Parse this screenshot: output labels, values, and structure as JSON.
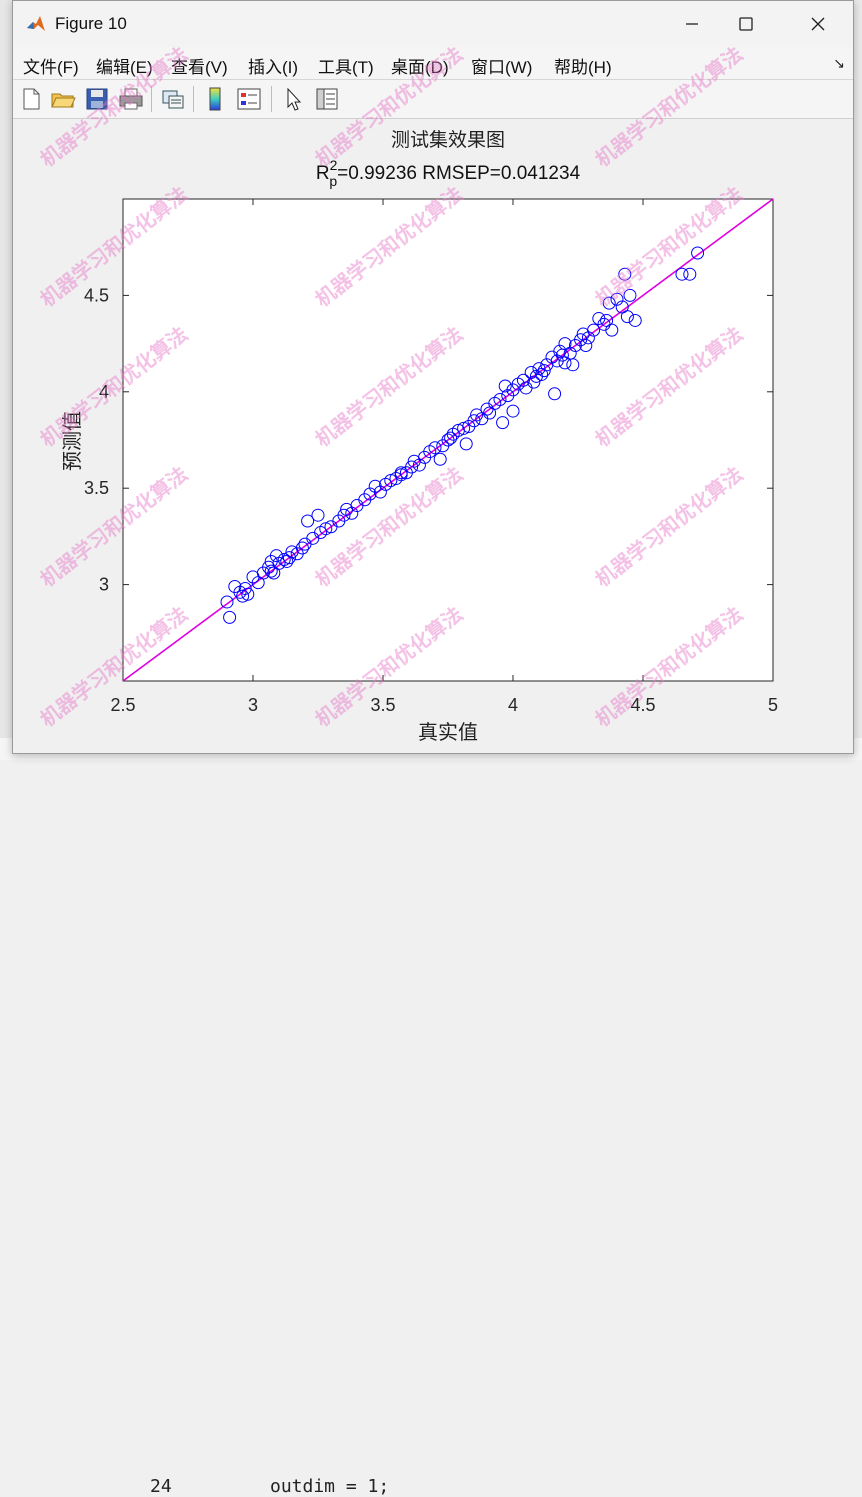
{
  "window": {
    "title": "Figure 10"
  },
  "menu": [
    "文件(F)",
    "编辑(E)",
    "查看(V)",
    "插入(I)",
    "工具(T)",
    "桌面(D)",
    "窗口(W)",
    "帮助(H)"
  ],
  "toolbar": [
    "new-figure-icon",
    "open-folder-icon",
    "save-icon",
    "print-icon",
    "link-plot-icon",
    "colorbar-icon",
    "legend-icon",
    "pointer-icon",
    "property-editor-icon"
  ],
  "background": {
    "line_number": "24",
    "code": "outdim = 1;"
  },
  "watermark": "机器学习和优化算法",
  "chart_data": {
    "type": "scatter",
    "title": "测试集效果图",
    "subtitle": {
      "r": "R",
      "sup": "2",
      "sub": "p",
      "rest": "=0.99236  RMSEP=0.041234"
    },
    "xlabel": "真实值",
    "ylabel": "预测值",
    "xlim": [
      2.5,
      5
    ],
    "ylim": [
      2.5,
      5
    ],
    "xticks": [
      "2.5",
      "3",
      "3.5",
      "4",
      "4.5",
      "5"
    ],
    "yticks": [
      "3",
      "3.5",
      "4",
      "4.5"
    ],
    "ytick_values": [
      3,
      3.5,
      4,
      4.5
    ],
    "xtick_values": [
      2.5,
      3,
      3.5,
      4,
      4.5,
      5
    ],
    "marker_color": "#0000ff",
    "line_color": "#e000e0",
    "line": [
      [
        2.5,
        2.5
      ],
      [
        5,
        5
      ]
    ],
    "points": [
      [
        2.9,
        2.91
      ],
      [
        2.91,
        2.83
      ],
      [
        2.93,
        2.99
      ],
      [
        2.95,
        2.96
      ],
      [
        2.96,
        2.94
      ],
      [
        2.97,
        2.98
      ],
      [
        2.98,
        2.95
      ],
      [
        3.0,
        3.04
      ],
      [
        3.02,
        3.01
      ],
      [
        3.04,
        3.06
      ],
      [
        3.06,
        3.09
      ],
      [
        3.07,
        3.12
      ],
      [
        3.08,
        3.06
      ],
      [
        3.09,
        3.15
      ],
      [
        3.1,
        3.11
      ],
      [
        3.12,
        3.13
      ],
      [
        3.14,
        3.14
      ],
      [
        3.15,
        3.17
      ],
      [
        3.17,
        3.16
      ],
      [
        3.19,
        3.19
      ],
      [
        3.2,
        3.21
      ],
      [
        3.21,
        3.33
      ],
      [
        3.23,
        3.24
      ],
      [
        3.25,
        3.36
      ],
      [
        3.26,
        3.27
      ],
      [
        3.28,
        3.29
      ],
      [
        3.3,
        3.3
      ],
      [
        3.33,
        3.33
      ],
      [
        3.35,
        3.36
      ],
      [
        3.36,
        3.39
      ],
      [
        3.38,
        3.37
      ],
      [
        3.4,
        3.41
      ],
      [
        3.43,
        3.44
      ],
      [
        3.45,
        3.47
      ],
      [
        3.47,
        3.51
      ],
      [
        3.49,
        3.48
      ],
      [
        3.51,
        3.52
      ],
      [
        3.53,
        3.54
      ],
      [
        3.55,
        3.55
      ],
      [
        3.57,
        3.57
      ],
      [
        3.59,
        3.58
      ],
      [
        3.61,
        3.61
      ],
      [
        3.62,
        3.64
      ],
      [
        3.64,
        3.62
      ],
      [
        3.66,
        3.66
      ],
      [
        3.68,
        3.69
      ],
      [
        3.7,
        3.71
      ],
      [
        3.72,
        3.65
      ],
      [
        3.73,
        3.72
      ],
      [
        3.75,
        3.75
      ],
      [
        3.77,
        3.78
      ],
      [
        3.79,
        3.8
      ],
      [
        3.81,
        3.81
      ],
      [
        3.82,
        3.73
      ],
      [
        3.83,
        3.82
      ],
      [
        3.85,
        3.85
      ],
      [
        3.86,
        3.88
      ],
      [
        3.88,
        3.86
      ],
      [
        3.9,
        3.91
      ],
      [
        3.91,
        3.89
      ],
      [
        3.93,
        3.94
      ],
      [
        3.95,
        3.96
      ],
      [
        3.96,
        3.84
      ],
      [
        3.97,
        4.03
      ],
      [
        3.98,
        3.98
      ],
      [
        4.0,
        3.9
      ],
      [
        4.0,
        4.01
      ],
      [
        4.02,
        4.04
      ],
      [
        4.04,
        4.06
      ],
      [
        4.05,
        4.02
      ],
      [
        4.07,
        4.1
      ],
      [
        4.08,
        4.05
      ],
      [
        4.09,
        4.08
      ],
      [
        4.1,
        4.12
      ],
      [
        4.12,
        4.11
      ],
      [
        4.13,
        4.14
      ],
      [
        4.15,
        4.18
      ],
      [
        4.16,
        3.99
      ],
      [
        4.17,
        4.16
      ],
      [
        4.18,
        4.21
      ],
      [
        4.19,
        4.19
      ],
      [
        4.2,
        4.25
      ],
      [
        4.22,
        4.2
      ],
      [
        4.23,
        4.14
      ],
      [
        4.24,
        4.24
      ],
      [
        4.26,
        4.27
      ],
      [
        4.27,
        4.3
      ],
      [
        4.29,
        4.28
      ],
      [
        4.31,
        4.32
      ],
      [
        4.33,
        4.38
      ],
      [
        4.35,
        4.35
      ],
      [
        4.36,
        4.37
      ],
      [
        4.37,
        4.46
      ],
      [
        4.38,
        4.32
      ],
      [
        4.4,
        4.48
      ],
      [
        4.42,
        4.44
      ],
      [
        4.43,
        4.61
      ],
      [
        4.44,
        4.39
      ],
      [
        4.45,
        4.5
      ],
      [
        4.47,
        4.37
      ],
      [
        4.65,
        4.61
      ],
      [
        4.68,
        4.61
      ],
      [
        4.71,
        4.72
      ],
      [
        4.2,
        4.15
      ],
      [
        3.76,
        3.76
      ],
      [
        3.57,
        3.58
      ],
      [
        3.13,
        3.12
      ],
      [
        3.07,
        3.07
      ],
      [
        4.11,
        4.09
      ],
      [
        4.28,
        4.24
      ]
    ]
  }
}
